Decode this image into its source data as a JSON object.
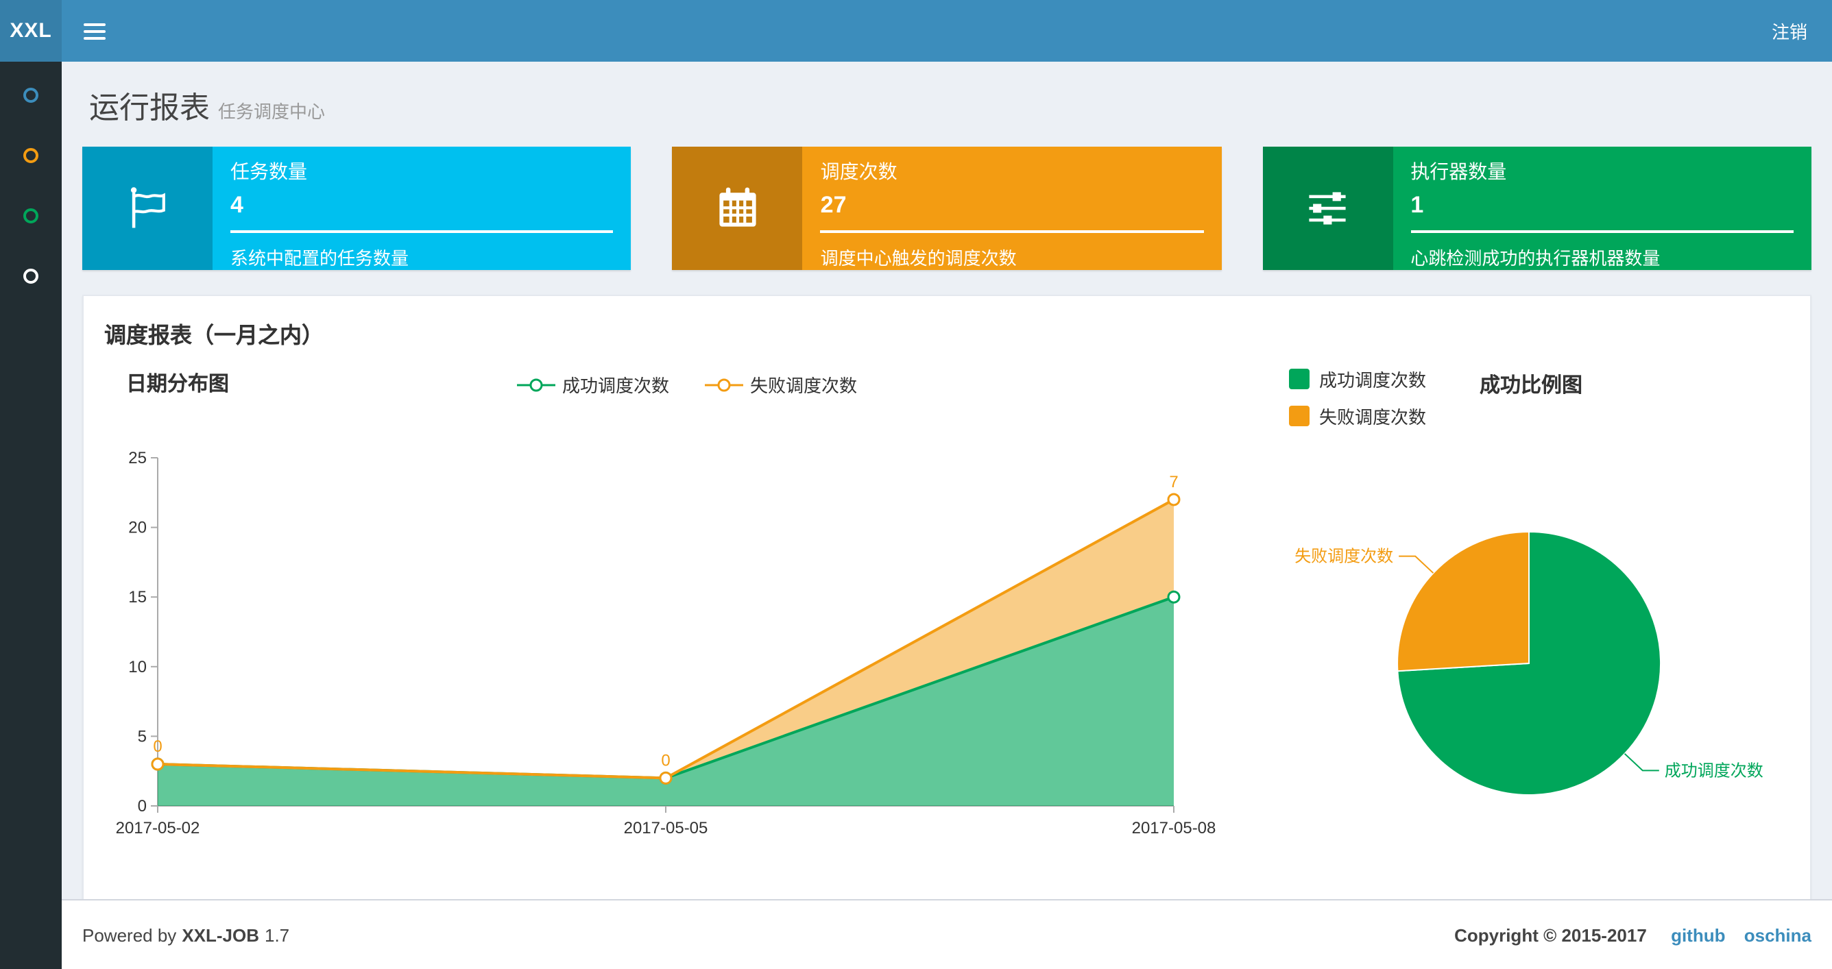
{
  "navbar": {
    "logo": "XXL",
    "logout": "注销"
  },
  "sidebar": {
    "items": [
      {
        "icon": "circle-icon",
        "color": "#3c8dbc"
      },
      {
        "icon": "circle-icon",
        "color": "#f39c12"
      },
      {
        "icon": "circle-icon",
        "color": "#00a65a"
      },
      {
        "icon": "circle-icon",
        "color": "#ffffff"
      }
    ]
  },
  "page": {
    "title": "运行报表",
    "subtitle": "任务调度中心"
  },
  "info_boxes": [
    {
      "icon": "flag-icon",
      "title": "任务数量",
      "number": "4",
      "desc": "系统中配置的任务数量",
      "color": "#00c0ef"
    },
    {
      "icon": "calendar-icon",
      "title": "调度次数",
      "number": "27",
      "desc": "调度中心触发的调度次数",
      "color": "#f39c12"
    },
    {
      "icon": "sliders-icon",
      "title": "执行器数量",
      "number": "1",
      "desc": "心跳检测成功的执行器机器数量",
      "color": "#00a65a"
    }
  ],
  "panel": {
    "title": "调度报表（一月之内）"
  },
  "chart_data": [
    {
      "type": "area",
      "title": "日期分布图",
      "categories": [
        "2017-05-02",
        "2017-05-05",
        "2017-05-08"
      ],
      "series": [
        {
          "name": "成功调度次数",
          "color": "#00a65a",
          "values": [
            3,
            2,
            15
          ],
          "stacked": true,
          "labels_visible": false
        },
        {
          "name": "失败调度次数",
          "color": "#f39c12",
          "values": [
            0,
            0,
            7
          ],
          "stacked": true,
          "labels_visible": true
        }
      ],
      "ylim": [
        0,
        25
      ],
      "y_ticks": [
        0,
        5,
        10,
        15,
        20,
        25
      ],
      "xlabel": "",
      "ylabel": "",
      "grid": false,
      "legend_position": "top-center"
    },
    {
      "type": "pie",
      "title": "成功比例图",
      "series": [
        {
          "name": "成功调度次数",
          "color": "#00a65a",
          "value": 20
        },
        {
          "name": "失败调度次数",
          "color": "#f39c12",
          "value": 7
        }
      ],
      "start_angle": 90,
      "legend_position": "top-left"
    }
  ],
  "footer": {
    "powered_by_prefix": "Powered by",
    "product": "XXL-JOB",
    "version": "1.7",
    "copyright": "Copyright © 2015-2017",
    "links": [
      "github",
      "oschina"
    ]
  },
  "colors": {
    "navbar": "#3c8dbc",
    "navbar_logo": "#367fa9",
    "sidebar": "#222d32",
    "content_bg": "#ecf0f5",
    "success": "#00a65a",
    "fail": "#f39c12",
    "aqua": "#00c0ef",
    "link": "#3c8dbc"
  }
}
